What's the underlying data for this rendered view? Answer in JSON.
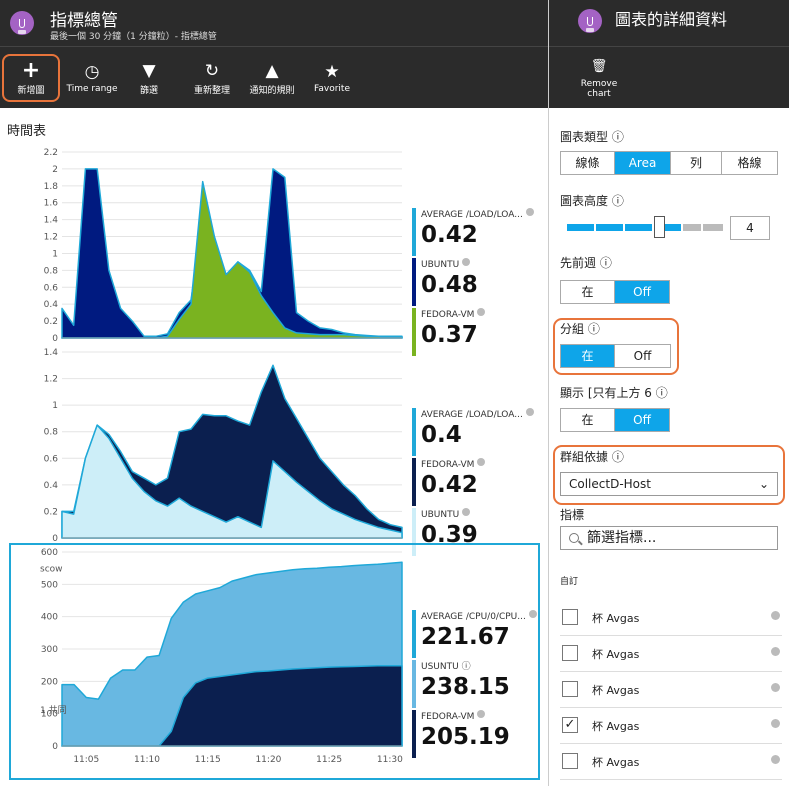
{
  "left_blade": {
    "title": "指標總管",
    "subtitle": "最後一個 30 分鐘（1 分鐘粒）- 指標總管",
    "toolbar": [
      {
        "icon": "plus-icon",
        "label": "新增圖"
      },
      {
        "icon": "clock-icon",
        "label": "Time range"
      },
      {
        "icon": "filter-icon",
        "label": "篩選"
      },
      {
        "icon": "refresh-icon",
        "label": "重新整理"
      },
      {
        "icon": "bell-icon",
        "label": "通知的規則"
      },
      {
        "icon": "bookmark-icon",
        "label": "Favorite"
      }
    ],
    "pane_title": "時間表",
    "accent_color": "#e8743b",
    "selection_color": "#1fa8d8"
  },
  "right_blade": {
    "title": "圖表的詳細資料",
    "toolbar": [
      {
        "icon": "trash-icon",
        "label_line1": "Remove",
        "label_line2": "chart"
      }
    ],
    "chart_type": {
      "label": "圖表類型 ⓘ",
      "options": [
        "線條",
        "Area",
        "列",
        "格線"
      ],
      "selected": "Area"
    },
    "chart_height": {
      "label": "圖表高度 ⓘ",
      "value": "4",
      "level": 4,
      "max": 6
    },
    "prev_period": {
      "label": "先前週 ⓘ",
      "options": [
        "在",
        "Off"
      ],
      "selected": "Off"
    },
    "grouping": {
      "label": "分組 ⓘ",
      "options": [
        "在",
        "Off"
      ],
      "selected": "在"
    },
    "show_top": {
      "label": "顯示 [只有上方 6 ⓘ",
      "options": [
        "在",
        "Off"
      ],
      "selected": "Off"
    },
    "group_by": {
      "label": "群組依據 ⓘ",
      "value": "CollectD-Host"
    },
    "metrics": {
      "label": "指標",
      "search_placeholder": "篩選指標..."
    },
    "custom_label": "自訂",
    "metric_rows": [
      {
        "name": "杯 Avgas",
        "checked": false
      },
      {
        "name": "杯 Avgas",
        "checked": false
      },
      {
        "name": "杯 Avgas",
        "checked": false
      },
      {
        "name": "杯 Avgas",
        "checked": true
      },
      {
        "name": "杯 Avgas",
        "checked": false
      }
    ]
  },
  "chart_data": [
    {
      "type": "area",
      "x": [
        0,
        1,
        2,
        3,
        4,
        5,
        6,
        7,
        8,
        9,
        10,
        11,
        12,
        13,
        14,
        15,
        16,
        17,
        18,
        19,
        20,
        21,
        22,
        23,
        24,
        25,
        26,
        27,
        28,
        29
      ],
      "ylim": [
        0,
        2.2
      ],
      "yticks": [
        "2.2",
        "2",
        "1.8",
        "1.6",
        "1.4",
        "1.2",
        "1",
        "0.8",
        "0.6",
        "0.4",
        "0.2",
        "0"
      ],
      "series": [
        {
          "name": "AVERAGE /LOAD/LOA...",
          "legend_value": "0.42",
          "color": "#001a80",
          "values": [
            0.35,
            0.15,
            2.0,
            2.0,
            0.8,
            0.35,
            0.2,
            0.02,
            0.02,
            0.05,
            0.3,
            0.45,
            1.4,
            0.9,
            0.7,
            0.9,
            0.8,
            0.55,
            2.0,
            1.9,
            0.3,
            0.2,
            0.12,
            0.1,
            0.06,
            0.04,
            0.03,
            0.02,
            0.02,
            0.02
          ]
        },
        {
          "name": "UBUNTU",
          "legend_value": "0.48",
          "color": "#001a80",
          "values": []
        },
        {
          "name": "FEDORA-VM",
          "legend_value": "0.37",
          "color": "#7ab320",
          "values": [
            0,
            0,
            0,
            0,
            0,
            0,
            0,
            0,
            0,
            0.02,
            0.22,
            0.4,
            1.85,
            1.2,
            0.75,
            0.9,
            0.78,
            0.5,
            0.3,
            0.12,
            0.06,
            0.05,
            0.04,
            0.04,
            0.04,
            0.03,
            0.02,
            0.02,
            0.01,
            0.01
          ]
        }
      ]
    },
    {
      "type": "area",
      "x": [
        0,
        1,
        2,
        3,
        4,
        5,
        6,
        7,
        8,
        9,
        10,
        11,
        12,
        13,
        14,
        15,
        16,
        17,
        18,
        19,
        20,
        21,
        22,
        23,
        24,
        25,
        26,
        27,
        28,
        29
      ],
      "ylim": [
        0,
        1.4
      ],
      "yticks": [
        "1.4",
        "1.2",
        "1",
        "0.8",
        "0.6",
        "0.4",
        "0.2",
        "0"
      ],
      "series": [
        {
          "name": "AVERAGE /LOAD/LOA...",
          "legend_value": "0.4",
          "color": "#1fa8d8",
          "values": []
        },
        {
          "name": "FEDORA-VM",
          "legend_value": "0.42",
          "color": "#0b1f4f",
          "values": [
            0.2,
            0.2,
            0.6,
            0.85,
            0.78,
            0.65,
            0.5,
            0.45,
            0.4,
            0.45,
            0.8,
            0.82,
            0.93,
            0.92,
            0.92,
            0.88,
            0.85,
            1.1,
            1.3,
            1.05,
            0.9,
            0.75,
            0.6,
            0.5,
            0.4,
            0.32,
            0.22,
            0.14,
            0.1,
            0.08
          ]
        },
        {
          "name": "UBUNTU",
          "legend_value": "0.39",
          "color": "#cdeef8",
          "values": [
            0.2,
            0.18,
            0.6,
            0.85,
            0.75,
            0.6,
            0.45,
            0.35,
            0.28,
            0.24,
            0.3,
            0.24,
            0.2,
            0.16,
            0.12,
            0.16,
            0.12,
            0.08,
            0.58,
            0.5,
            0.42,
            0.35,
            0.28,
            0.22,
            0.18,
            0.14,
            0.11,
            0.08,
            0.06,
            0.04
          ]
        }
      ]
    },
    {
      "type": "area",
      "x": [
        "11:03",
        "11:04",
        "11:05",
        "11:06",
        "11:07",
        "11:08",
        "11:09",
        "11:10",
        "11:11",
        "11:12",
        "11:13",
        "11:14",
        "11:15",
        "11:16",
        "11:17",
        "11:18",
        "11:19",
        "11:20",
        "11:21",
        "11:22",
        "11:23",
        "11:24",
        "11:25",
        "11:26",
        "11:27",
        "11:28",
        "11:29",
        "11:30",
        "11:31"
      ],
      "xticks": [
        "11:05",
        "11:10",
        "11:15",
        "11:20",
        "11:25",
        "11:30"
      ],
      "ylim": [
        0,
        600
      ],
      "yticks": [
        "600",
        "500",
        "400",
        "300",
        "200",
        "100",
        "0"
      ],
      "annotations": [
        "scow",
        "1 共同"
      ],
      "series": [
        {
          "name": "AVERAGE /CPU/0/CPU...",
          "legend_value": "221.67",
          "color": "#1fa8d8",
          "values": []
        },
        {
          "name": "USUNTU ⓘ",
          "legend_value": "238.15",
          "color": "#68b8e2",
          "values": [
            190,
            190,
            150,
            145,
            210,
            235,
            235,
            275,
            280,
            395,
            445,
            470,
            480,
            490,
            510,
            520,
            530,
            535,
            540,
            545,
            548,
            550,
            553,
            555,
            558,
            560,
            562,
            565,
            568
          ]
        },
        {
          "name": "FEDORA-VM",
          "legend_value": "205.19",
          "color": "#0b1f4f",
          "values": [
            0,
            0,
            0,
            0,
            0,
            0,
            0,
            0,
            0,
            45,
            150,
            195,
            210,
            215,
            220,
            225,
            230,
            232,
            235,
            238,
            240,
            242,
            244,
            245,
            246,
            247,
            248,
            248,
            248
          ]
        }
      ]
    }
  ]
}
